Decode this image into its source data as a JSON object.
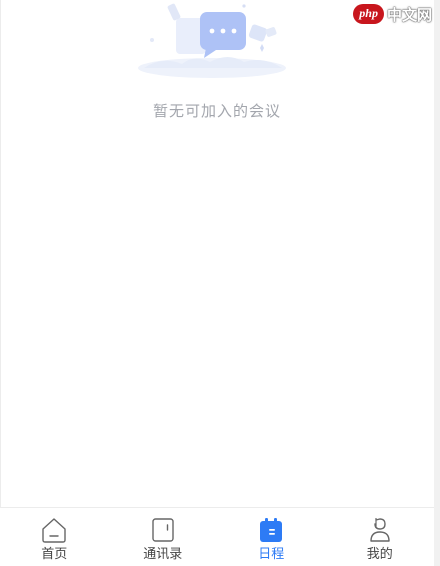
{
  "empty_state": {
    "message": "暂无可加入的会议"
  },
  "watermark": {
    "logo": "php",
    "text": "中文网"
  },
  "tabbar": {
    "active_color": "#2d7bf5",
    "items": [
      {
        "label": "首页",
        "icon": "home-icon",
        "active": false
      },
      {
        "label": "通讯录",
        "icon": "contacts-icon",
        "active": false
      },
      {
        "label": "日程",
        "icon": "calendar-icon",
        "active": true
      },
      {
        "label": "我的",
        "icon": "profile-icon",
        "active": false
      }
    ]
  }
}
